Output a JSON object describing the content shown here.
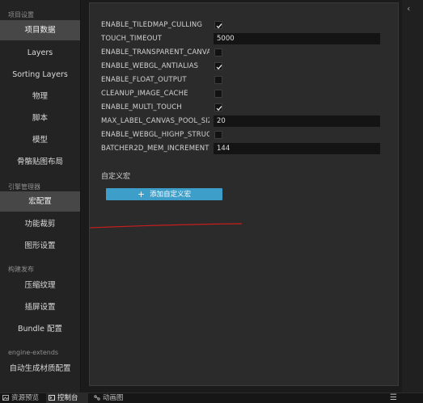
{
  "sidebar": {
    "sections": [
      {
        "label": "项目设置"
      },
      {
        "label": "引擎管理器"
      },
      {
        "label": "构建发布"
      },
      {
        "label": "engine-extends"
      }
    ],
    "items": [
      {
        "label": "项目数据"
      },
      {
        "label": "Layers"
      },
      {
        "label": "Sorting Layers"
      },
      {
        "label": "物理"
      },
      {
        "label": "脚本"
      },
      {
        "label": "模型"
      },
      {
        "label": "骨骼贴图布局"
      },
      {
        "label": "宏配置"
      },
      {
        "label": "功能裁剪"
      },
      {
        "label": "图形设置"
      },
      {
        "label": "压缩纹理"
      },
      {
        "label": "插屏设置"
      },
      {
        "label": "Bundle 配置"
      },
      {
        "label": "自动生成材质配置"
      }
    ],
    "active_item": "宏配置"
  },
  "macros": [
    {
      "name": "ENABLE_TILEDMAP_CULLING",
      "type": "checkbox",
      "checked": true
    },
    {
      "name": "TOUCH_TIMEOUT",
      "type": "text",
      "value": "5000"
    },
    {
      "name": "ENABLE_TRANSPARENT_CANVAS",
      "type": "checkbox",
      "checked": false
    },
    {
      "name": "ENABLE_WEBGL_ANTIALIAS",
      "type": "checkbox",
      "checked": true
    },
    {
      "name": "ENABLE_FLOAT_OUTPUT",
      "type": "checkbox",
      "checked": false
    },
    {
      "name": "CLEANUP_IMAGE_CACHE",
      "type": "checkbox",
      "checked": false
    },
    {
      "name": "ENABLE_MULTI_TOUCH",
      "type": "checkbox",
      "checked": true
    },
    {
      "name": "MAX_LABEL_CANVAS_POOL_SIZE",
      "type": "text",
      "value": "20"
    },
    {
      "name": "ENABLE_WEBGL_HIGHP_STRUCT_VALUES",
      "type": "checkbox",
      "checked": false
    },
    {
      "name": "BATCHER2D_MEM_INCREMENT",
      "type": "text",
      "value": "144"
    }
  ],
  "custom_macros": {
    "title": "自定义宏",
    "add_button_label": "添加自定义宏"
  },
  "bottom_tabs": [
    {
      "label": "资源预览",
      "icon": "image-icon",
      "active": false
    },
    {
      "label": "控制台",
      "icon": "terminal-icon",
      "active": true
    },
    {
      "label": "动画图",
      "icon": "graph-icon",
      "active": false
    }
  ],
  "icons": {
    "collapse": "chevron-left-icon",
    "menu": "hamburger-menu-icon",
    "add": "plus-icon",
    "check": "checkmark-icon"
  },
  "colors": {
    "accent_button": "#3d9fc9",
    "annotation_line": "#c81e1e",
    "active_nav": "#474747"
  }
}
